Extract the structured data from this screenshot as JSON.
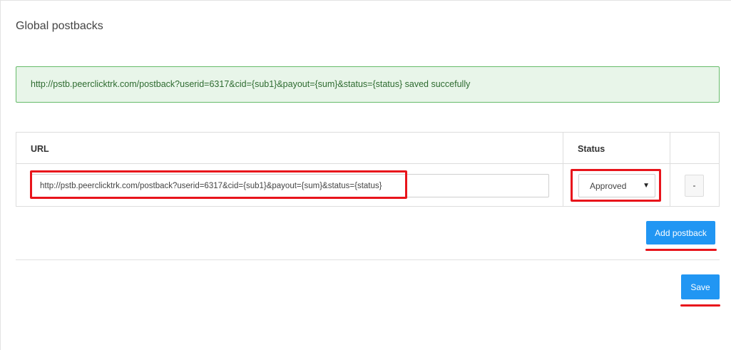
{
  "page": {
    "title": "Global postbacks"
  },
  "alert": {
    "message": "http://pstb.peerclicktrk.com/postback?userid=6317&cid={sub1}&payout={sum}&status={status} saved succefully",
    "color": "#e8f5e9"
  },
  "table": {
    "headers": {
      "url": "URL",
      "status": "Status"
    },
    "rows": [
      {
        "url": "http://pstb.peerclicktrk.com/postback?userid=6317&cid={sub1}&payout={sum}&status={status}",
        "status": "Approved",
        "remove_label": "-"
      }
    ]
  },
  "buttons": {
    "add_postback": "Add postback",
    "save": "Save",
    "accent_color": "#2196f3"
  },
  "annotations": {
    "color": "#e8141b"
  }
}
